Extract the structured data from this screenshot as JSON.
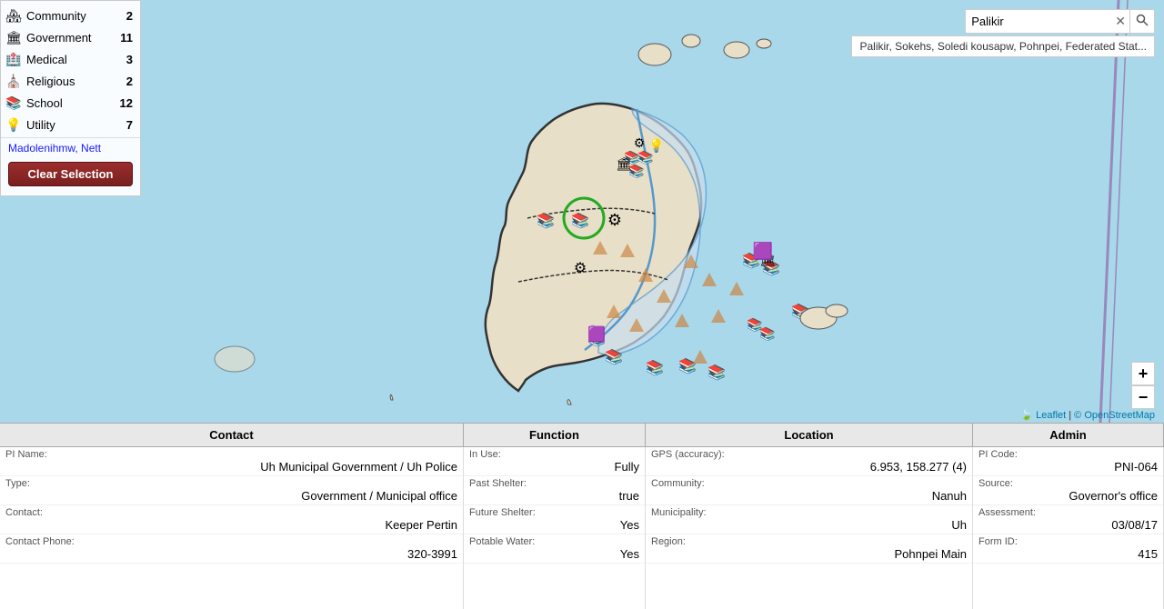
{
  "legend": {
    "items": [
      {
        "id": "community",
        "label": "Community",
        "count": 2,
        "icon": "🏘",
        "color": "#4488cc"
      },
      {
        "id": "government",
        "label": "Government",
        "count": 11,
        "icon": "🏛",
        "color": "#4488cc"
      },
      {
        "id": "medical",
        "label": "Medical",
        "count": 3,
        "icon": "🏥",
        "color": "#4488cc"
      },
      {
        "id": "religious",
        "label": "Religious",
        "count": 2,
        "icon": "⛪",
        "color": "#4488cc"
      },
      {
        "id": "school",
        "label": "School",
        "count": 12,
        "icon": "📚",
        "color": "#4488cc"
      },
      {
        "id": "utility",
        "label": "Utility",
        "count": 7,
        "icon": "💡",
        "color": "#4488cc"
      }
    ],
    "selected_area": "Madolenihmw, Nett",
    "clear_button": "Clear Selection"
  },
  "search": {
    "value": "Palikir",
    "suggestion": "Palikir, Sokehs, Soledi kousapw, Pohnpei, Federated Stat...",
    "clear_icon": "✕",
    "search_icon": "🔍"
  },
  "zoom": {
    "plus": "+",
    "minus": "−"
  },
  "attribution": {
    "leaflet": "Leaflet",
    "osm": "© OpenStreetMap"
  },
  "info_table": {
    "headers": [
      "Contact",
      "Function",
      "Location",
      "Admin"
    ],
    "contact": {
      "pi_name_label": "PI Name:",
      "pi_name_value": "Uh Municipal Government / Uh Police",
      "type_label": "Type:",
      "type_value": "Government / Municipal office",
      "contact_label": "Contact:",
      "contact_value": "Keeper Pertin",
      "contact_phone_label": "Contact Phone:",
      "contact_phone_value": "320-3991"
    },
    "function": {
      "in_use_label": "In Use:",
      "in_use_value": "Fully",
      "past_shelter_label": "Past Shelter:",
      "past_shelter_value": "true",
      "future_shelter_label": "Future Shelter:",
      "future_shelter_value": "Yes",
      "potable_water_label": "Potable Water:",
      "potable_water_value": "Yes"
    },
    "location": {
      "gps_label": "GPS (accuracy):",
      "gps_value": "6.953, 158.277 (4)",
      "community_label": "Community:",
      "community_value": "Nanuh",
      "municipality_label": "Municipality:",
      "municipality_value": "Uh",
      "region_label": "Region:",
      "region_value": "Pohnpei Main"
    },
    "admin": {
      "pi_code_label": "PI Code:",
      "pi_code_value": "PNI-064",
      "source_label": "Source:",
      "source_value": "Governor's office",
      "assessment_label": "Assessment:",
      "assessment_value": "03/08/17",
      "form_id_label": "Form ID:",
      "form_id_value": "415"
    }
  }
}
